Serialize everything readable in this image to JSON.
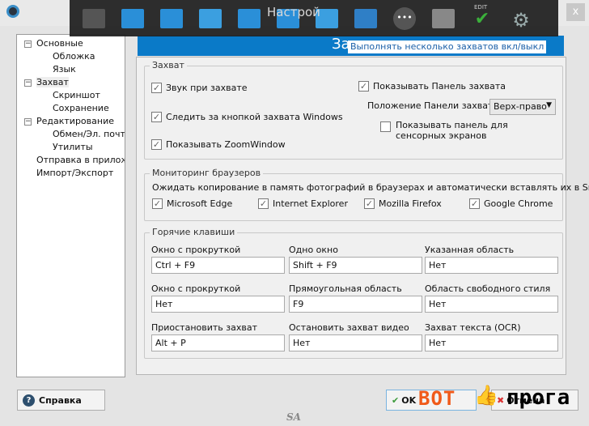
{
  "window": {
    "title": "Настрой",
    "close": "x"
  },
  "toolbar": {
    "items": [
      {
        "icon": "video-clapper-icon"
      },
      {
        "icon": "camera-download-icon"
      },
      {
        "icon": "camera-www-icon"
      },
      {
        "icon": "window-capture-icon"
      },
      {
        "icon": "region-capture-icon"
      },
      {
        "icon": "freehand-capture-icon"
      },
      {
        "icon": "scroll-window-capture-icon"
      },
      {
        "icon": "text-capture-icon"
      },
      {
        "icon": "more-icon"
      },
      {
        "icon": "multi-capture-icon"
      },
      {
        "icon": "edit-check-icon",
        "label": "EDIT"
      },
      {
        "icon": "settings-gears-icon"
      }
    ]
  },
  "tooltip": "Выполнять несколько захватов вкл/выкл",
  "header": {
    "title": "За"
  },
  "tree": [
    {
      "label": "Основные",
      "level": 0,
      "expander": "−"
    },
    {
      "label": "Обложка",
      "level": 1
    },
    {
      "label": "Язык",
      "level": 1
    },
    {
      "label": "Захват",
      "level": 0,
      "expander": "−",
      "selected": true
    },
    {
      "label": "Скриншот",
      "level": 1
    },
    {
      "label": "Сохранение",
      "level": 1
    },
    {
      "label": "Редактирование",
      "level": 0,
      "expander": "−"
    },
    {
      "label": "Обмен/Эл. почта",
      "level": 1
    },
    {
      "label": "Утилиты",
      "level": 1
    },
    {
      "label": "Отправка в приложения",
      "level": 0
    },
    {
      "label": "Импорт/Экспорт",
      "level": 0
    }
  ],
  "capture": {
    "legend": "Захват",
    "sound": {
      "label": "Звук при захвате",
      "checked": true
    },
    "watch_key": {
      "label": "Следить за кнопкой захвата Windows",
      "checked": true
    },
    "zoom_window": {
      "label": "Показывать ZoomWindow",
      "checked": true
    },
    "show_panel": {
      "label": "Показывать Панель захвата",
      "checked": true
    },
    "panel_pos_label": "Положение Панели захвата",
    "panel_pos_value": "Верх-право",
    "touch_panel": {
      "label": "Показывать панель для сенсорных экранов",
      "checked": false
    }
  },
  "browsers": {
    "legend": "Мониторинг браузеров",
    "description": "Ожидать копирование в память фотографий в браузерах и автоматически вставлять их в Snap",
    "items": [
      {
        "label": "Microsoft Edge",
        "checked": true
      },
      {
        "label": "Internet Explorer",
        "checked": true
      },
      {
        "label": "Mozilla Firefox",
        "checked": true
      },
      {
        "label": "Google Chrome",
        "checked": true
      }
    ]
  },
  "hotkeys": {
    "legend": "Горячие клавиши",
    "items": [
      {
        "label": "Окно с прокруткой",
        "value": "Ctrl + F9"
      },
      {
        "label": "Одно окно",
        "value": "Shift + F9"
      },
      {
        "label": "Указанная область",
        "value": "Нет"
      },
      {
        "label": "Окно с прокруткой",
        "value": "Нет"
      },
      {
        "label": "Прямоугольная область",
        "value": "F9"
      },
      {
        "label": "Область свободного стиля",
        "value": "Нет"
      },
      {
        "label": "Приостановить захват",
        "value": "Alt + P"
      },
      {
        "label": "Остановить захват видео",
        "value": "Нет"
      },
      {
        "label": "Захват текста (OCR)",
        "value": "Нет"
      }
    ]
  },
  "buttons": {
    "help": "Справка",
    "ok": "OK",
    "cancel": "Отмена"
  },
  "watermark": {
    "text1": "ВОТ",
    "text2": "прога",
    "sig": "SA"
  },
  "colors": {
    "accent": "#0a7ac8",
    "toolbar": "#1e1e1e"
  }
}
